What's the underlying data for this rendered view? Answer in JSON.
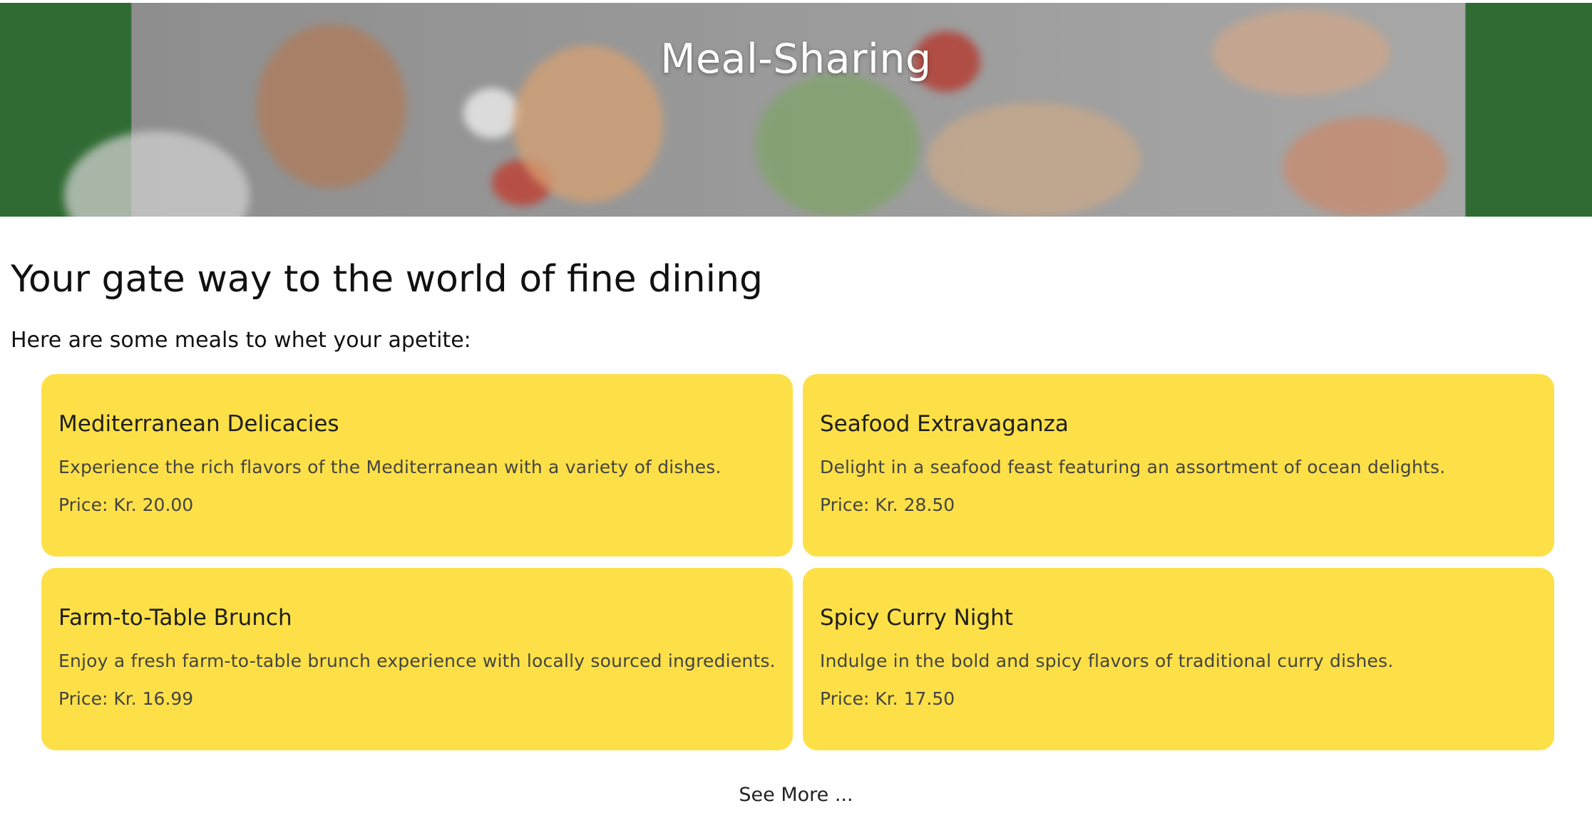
{
  "header": {
    "title": "Meal-Sharing"
  },
  "main": {
    "headline": "Your gate way to the world of fine dining",
    "intro": "Here are some meals to whet your apetite:",
    "meals": [
      {
        "title": "Mediterranean Delicacies",
        "description": "Experience the rich flavors of the Mediterranean with a variety of dishes.",
        "price": "Price: Kr. 20.00"
      },
      {
        "title": "Seafood Extravaganza",
        "description": "Delight in a seafood feast featuring an assortment of ocean delights.",
        "price": "Price: Kr. 28.50"
      },
      {
        "title": "Farm-to-Table Brunch",
        "description": "Enjoy a fresh farm-to-table brunch experience with locally sourced ingredients.",
        "price": "Price: Kr. 16.99"
      },
      {
        "title": "Spicy Curry Night",
        "description": "Indulge in the bold and spicy flavors of traditional curry dishes.",
        "price": "Price: Kr. 17.50"
      }
    ],
    "see_more_label": "See More ..."
  },
  "colors": {
    "card_background": "#fde047",
    "page_background": "#ffffff"
  }
}
